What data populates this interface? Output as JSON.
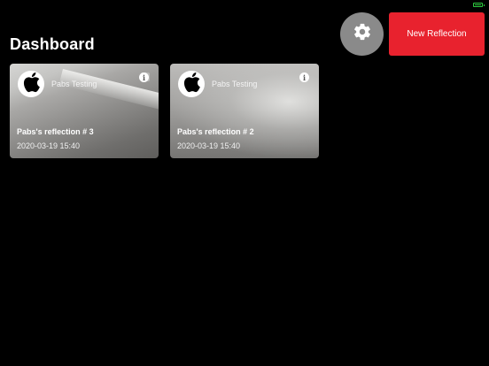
{
  "header": {
    "title": "Dashboard",
    "new_button_label": "New Reflection",
    "settings_icon": "gear-icon"
  },
  "status_bar": {
    "battery_icon": "battery-icon",
    "battery_color": "#2ecc40"
  },
  "cards": [
    {
      "author": "Pabs Testing",
      "title": "Pabs's reflection # 3",
      "date": "2020-03-19 15:40",
      "avatar_icon": "apple-logo-icon",
      "info_icon": "info-icon",
      "info_glyph": "i"
    },
    {
      "author": "Pabs Testing",
      "title": "Pabs's reflection # 2",
      "date": "2020-03-19 15:40",
      "avatar_icon": "apple-logo-icon",
      "info_icon": "info-icon",
      "info_glyph": "i"
    }
  ],
  "colors": {
    "background": "#000000",
    "accent": "#e8222e",
    "settings_button": "#8a8a8a"
  }
}
